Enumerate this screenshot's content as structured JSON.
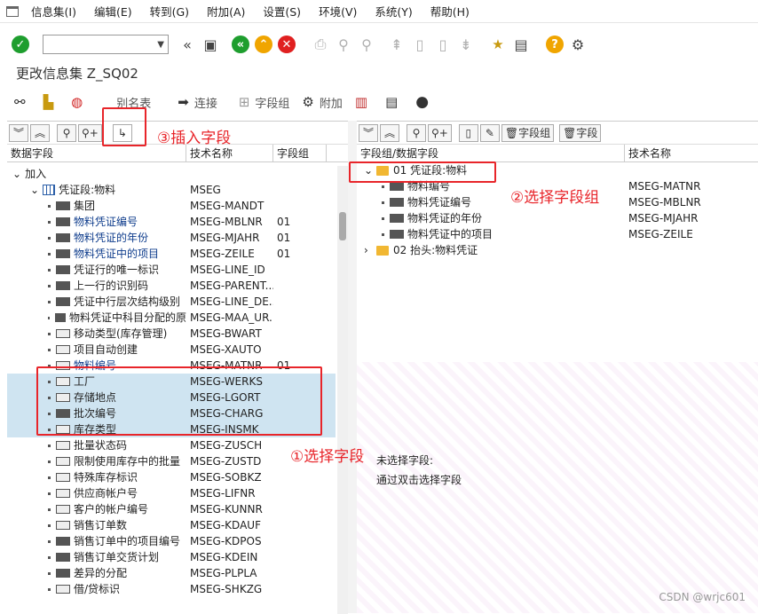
{
  "menu": {
    "items": [
      "信息集(I)",
      "编辑(E)",
      "转到(G)",
      "附加(A)",
      "设置(S)",
      "环境(V)",
      "系统(Y)",
      "帮助(H)"
    ]
  },
  "screen_title": "更改信息集 Z_SQ02",
  "app_toolbar": {
    "alias_table": "别名表",
    "join": "连接",
    "field_group": "字段组",
    "extras": "附加"
  },
  "left_pane": {
    "toolbar": {
      "field_group_btn": "",
      "field_btn": ""
    },
    "columns": [
      "数据字段",
      "技术名称",
      "字段组"
    ],
    "rows": [
      {
        "indent": 0,
        "kind": "root",
        "label": "加入",
        "tech": "",
        "grp": "",
        "blue": false,
        "sel": false,
        "icon": "expand-icon"
      },
      {
        "indent": 1,
        "kind": "table",
        "label": "凭证段:物料",
        "tech": "MSEG",
        "grp": "",
        "blue": false,
        "sel": false,
        "icon": "table-icon"
      },
      {
        "indent": 2,
        "kind": "field",
        "label": "集团",
        "tech": "MSEG-MANDT",
        "grp": "",
        "blue": false,
        "sel": false,
        "icon": "field-dark-icon"
      },
      {
        "indent": 2,
        "kind": "field",
        "label": "物料凭证编号",
        "tech": "MSEG-MBLNR",
        "grp": "01",
        "blue": true,
        "sel": false,
        "icon": "field-dark-icon"
      },
      {
        "indent": 2,
        "kind": "field",
        "label": "物料凭证的年份",
        "tech": "MSEG-MJAHR",
        "grp": "01",
        "blue": true,
        "sel": false,
        "icon": "field-dark-icon"
      },
      {
        "indent": 2,
        "kind": "field",
        "label": "物料凭证中的项目",
        "tech": "MSEG-ZEILE",
        "grp": "01",
        "blue": true,
        "sel": false,
        "icon": "field-dark-icon"
      },
      {
        "indent": 2,
        "kind": "field",
        "label": "凭证行的唯一标识",
        "tech": "MSEG-LINE_ID",
        "grp": "",
        "blue": false,
        "sel": false,
        "icon": "field-dark-icon"
      },
      {
        "indent": 2,
        "kind": "field",
        "label": "上一行的识别码",
        "tech": "MSEG-PARENT...",
        "grp": "",
        "blue": false,
        "sel": false,
        "icon": "field-dark-icon"
      },
      {
        "indent": 2,
        "kind": "field",
        "label": "凭证中行层次结构级别",
        "tech": "MSEG-LINE_DE...",
        "grp": "",
        "blue": false,
        "sel": false,
        "icon": "field-dark-icon"
      },
      {
        "indent": 2,
        "kind": "field",
        "label": "物料凭证中科目分配的原",
        "tech": "MSEG-MAA_UR...",
        "grp": "",
        "blue": false,
        "sel": false,
        "icon": "field-dark-icon"
      },
      {
        "indent": 2,
        "kind": "field",
        "label": "移动类型(库存管理)",
        "tech": "MSEG-BWART",
        "grp": "",
        "blue": false,
        "sel": false,
        "icon": "field-key-icon"
      },
      {
        "indent": 2,
        "kind": "field",
        "label": "项目自动创建",
        "tech": "MSEG-XAUTO",
        "grp": "",
        "blue": false,
        "sel": false,
        "icon": "field-key-icon"
      },
      {
        "indent": 2,
        "kind": "field",
        "label": "物料编号",
        "tech": "MSEG-MATNR",
        "grp": "01",
        "blue": true,
        "sel": false,
        "icon": "field-key-icon"
      },
      {
        "indent": 2,
        "kind": "field",
        "label": "工厂",
        "tech": "MSEG-WERKS",
        "grp": "",
        "blue": false,
        "sel": true,
        "icon": "field-key-icon"
      },
      {
        "indent": 2,
        "kind": "field",
        "label": "存储地点",
        "tech": "MSEG-LGORT",
        "grp": "",
        "blue": false,
        "sel": true,
        "icon": "field-key-icon"
      },
      {
        "indent": 2,
        "kind": "field",
        "label": "批次编号",
        "tech": "MSEG-CHARG",
        "grp": "",
        "blue": false,
        "sel": true,
        "icon": "field-dark-icon"
      },
      {
        "indent": 2,
        "kind": "field",
        "label": "库存类型",
        "tech": "MSEG-INSMK",
        "grp": "",
        "blue": false,
        "sel": true,
        "icon": "field-key-icon"
      },
      {
        "indent": 2,
        "kind": "field",
        "label": "批量状态码",
        "tech": "MSEG-ZUSCH",
        "grp": "",
        "blue": false,
        "sel": false,
        "icon": "field-key-icon"
      },
      {
        "indent": 2,
        "kind": "field",
        "label": "限制使用库存中的批量",
        "tech": "MSEG-ZUSTD",
        "grp": "",
        "blue": false,
        "sel": false,
        "icon": "field-key-icon"
      },
      {
        "indent": 2,
        "kind": "field",
        "label": "特殊库存标识",
        "tech": "MSEG-SOBKZ",
        "grp": "",
        "blue": false,
        "sel": false,
        "icon": "field-key-icon"
      },
      {
        "indent": 2,
        "kind": "field",
        "label": "供应商帐户号",
        "tech": "MSEG-LIFNR",
        "grp": "",
        "blue": false,
        "sel": false,
        "icon": "field-key-icon"
      },
      {
        "indent": 2,
        "kind": "field",
        "label": "客户的帐户编号",
        "tech": "MSEG-KUNNR",
        "grp": "",
        "blue": false,
        "sel": false,
        "icon": "field-key-icon"
      },
      {
        "indent": 2,
        "kind": "field",
        "label": "销售订单数",
        "tech": "MSEG-KDAUF",
        "grp": "",
        "blue": false,
        "sel": false,
        "icon": "field-key-icon"
      },
      {
        "indent": 2,
        "kind": "field",
        "label": "销售订单中的项目编号",
        "tech": "MSEG-KDPOS",
        "grp": "",
        "blue": false,
        "sel": false,
        "icon": "field-dark-icon"
      },
      {
        "indent": 2,
        "kind": "field",
        "label": "销售订单交货计划",
        "tech": "MSEG-KDEIN",
        "grp": "",
        "blue": false,
        "sel": false,
        "icon": "field-dark-icon"
      },
      {
        "indent": 2,
        "kind": "field",
        "label": "差异的分配",
        "tech": "MSEG-PLPLA",
        "grp": "",
        "blue": false,
        "sel": false,
        "icon": "field-dark-icon"
      },
      {
        "indent": 2,
        "kind": "field",
        "label": "借/贷标识",
        "tech": "MSEG-SHKZG",
        "grp": "",
        "blue": false,
        "sel": false,
        "icon": "field-key-icon"
      }
    ]
  },
  "right_pane": {
    "toolbar": {
      "field_group_btn": "字段组",
      "field_btn": "字段"
    },
    "columns": [
      "字段组/数据字段",
      "技术名称"
    ],
    "rows": [
      {
        "indent": 0,
        "kind": "group",
        "label": "01 凭证段:物料",
        "tech": "",
        "open": true
      },
      {
        "indent": 1,
        "kind": "field",
        "label": "物料编号",
        "tech": "MSEG-MATNR"
      },
      {
        "indent": 1,
        "kind": "field",
        "label": "物料凭证编号",
        "tech": "MSEG-MBLNR"
      },
      {
        "indent": 1,
        "kind": "field",
        "label": "物料凭证的年份",
        "tech": "MSEG-MJAHR"
      },
      {
        "indent": 1,
        "kind": "field",
        "label": "物料凭证中的项目",
        "tech": "MSEG-ZEILE"
      },
      {
        "indent": 0,
        "kind": "group",
        "label": "02 抬头:物料凭证",
        "tech": "",
        "open": false
      }
    ]
  },
  "lower_pane": {
    "line1": "未选择字段:",
    "line2": "通过双击选择字段"
  },
  "annotations": {
    "a1": "①选择字段",
    "a2": "②选择字段组",
    "a3": "③插入字段"
  },
  "watermark": "CSDN @wrjc601",
  "colors": {
    "highlight": "#cfe4f1",
    "annotation": "#e8252a",
    "group_blue": "#0e3c8c"
  }
}
